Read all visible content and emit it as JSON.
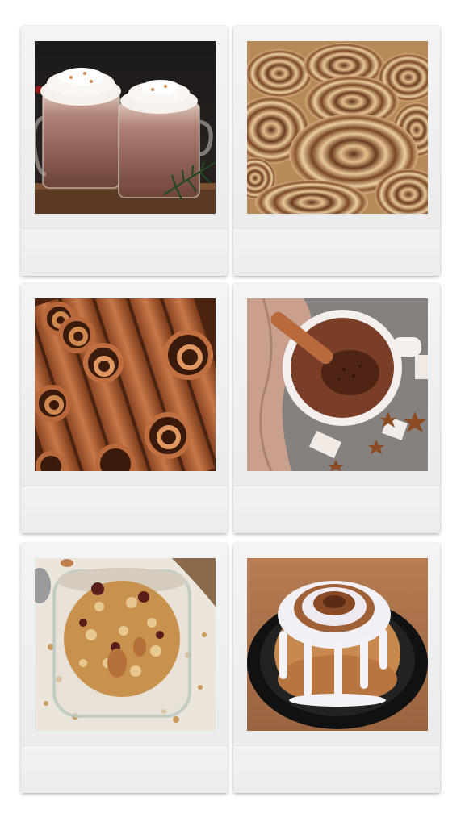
{
  "page": {
    "background": "#ffffff"
  },
  "cards": [
    {
      "subject": "hot-chocolate-mugs",
      "caption": ""
    },
    {
      "subject": "cinnamon-rolls-tray",
      "caption": ""
    },
    {
      "subject": "cinnamon-sticks",
      "caption": ""
    },
    {
      "subject": "hot-cocoa-cup",
      "caption": ""
    },
    {
      "subject": "granola-jar",
      "caption": ""
    },
    {
      "subject": "glazed-cinnamon-roll",
      "caption": ""
    }
  ]
}
